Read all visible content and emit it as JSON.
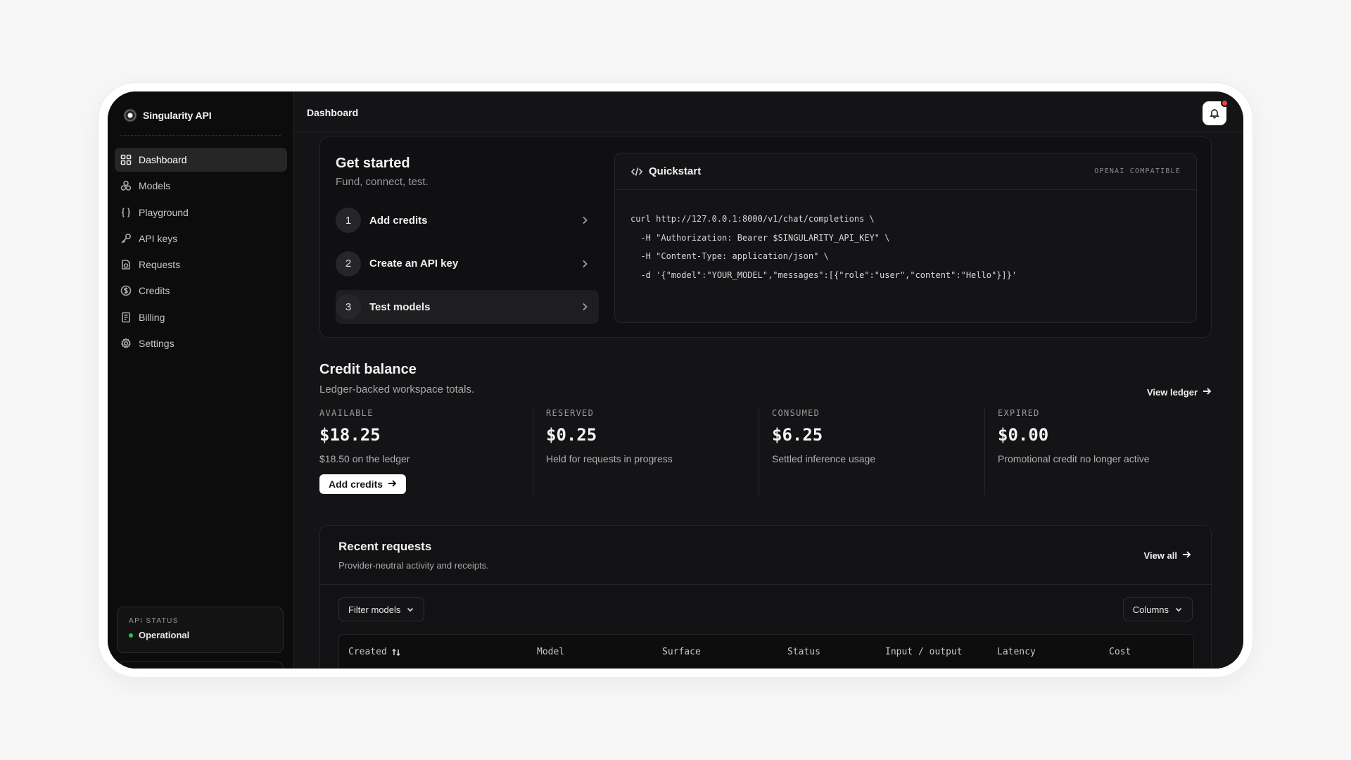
{
  "app": {
    "name": "Singularity API"
  },
  "sidebar": {
    "items": [
      {
        "label": "Dashboard",
        "icon": "dashboard-icon",
        "active": true
      },
      {
        "label": "Models",
        "icon": "models-icon",
        "active": false
      },
      {
        "label": "Playground",
        "icon": "braces-icon",
        "active": false
      },
      {
        "label": "API keys",
        "icon": "key-icon",
        "active": false
      },
      {
        "label": "Requests",
        "icon": "requests-icon",
        "active": false
      },
      {
        "label": "Credits",
        "icon": "dollar-circle-icon",
        "active": false
      },
      {
        "label": "Billing",
        "icon": "receipt-icon",
        "active": false
      },
      {
        "label": "Settings",
        "icon": "gear-icon",
        "active": false
      }
    ],
    "status": {
      "label": "API STATUS",
      "value": "Operational",
      "color": "#22c55e"
    }
  },
  "header": {
    "title": "Dashboard",
    "notification_indicator_color": "#ef4444"
  },
  "get_started": {
    "title": "Get started",
    "subtitle": "Fund, connect, test.",
    "steps": [
      {
        "number": "1",
        "label": "Add credits"
      },
      {
        "number": "2",
        "label": "Create an API key"
      },
      {
        "number": "3",
        "label": "Test models"
      }
    ]
  },
  "quickstart": {
    "title": "Quickstart",
    "badge": "OPENAI COMPATIBLE",
    "code": "curl http://127.0.0.1:8000/v1/chat/completions \\\n  -H \"Authorization: Bearer $SINGULARITY_API_KEY\" \\\n  -H \"Content-Type: application/json\" \\\n  -d '{\"model\":\"YOUR_MODEL\",\"messages\":[{\"role\":\"user\",\"content\":\"Hello\"}]}'"
  },
  "credit_balance": {
    "title": "Credit balance",
    "subtitle": "Ledger-backed workspace totals.",
    "view_ledger": "View ledger",
    "add_credits": "Add credits",
    "stats": [
      {
        "label": "AVAILABLE",
        "value": "$18.25",
        "note": "$18.50 on the ledger"
      },
      {
        "label": "RESERVED",
        "value": "$0.25",
        "note": "Held for requests in progress"
      },
      {
        "label": "CONSUMED",
        "value": "$6.25",
        "note": "Settled inference usage"
      },
      {
        "label": "EXPIRED",
        "value": "$0.00",
        "note": "Promotional credit no longer active"
      }
    ]
  },
  "recent_requests": {
    "title": "Recent requests",
    "subtitle": "Provider-neutral activity and receipts.",
    "view_all": "View all",
    "filter_label": "Filter models",
    "columns_label": "Columns",
    "columns": [
      "Created",
      "Model",
      "Surface",
      "Status",
      "Input / output",
      "Latency",
      "Cost"
    ]
  }
}
